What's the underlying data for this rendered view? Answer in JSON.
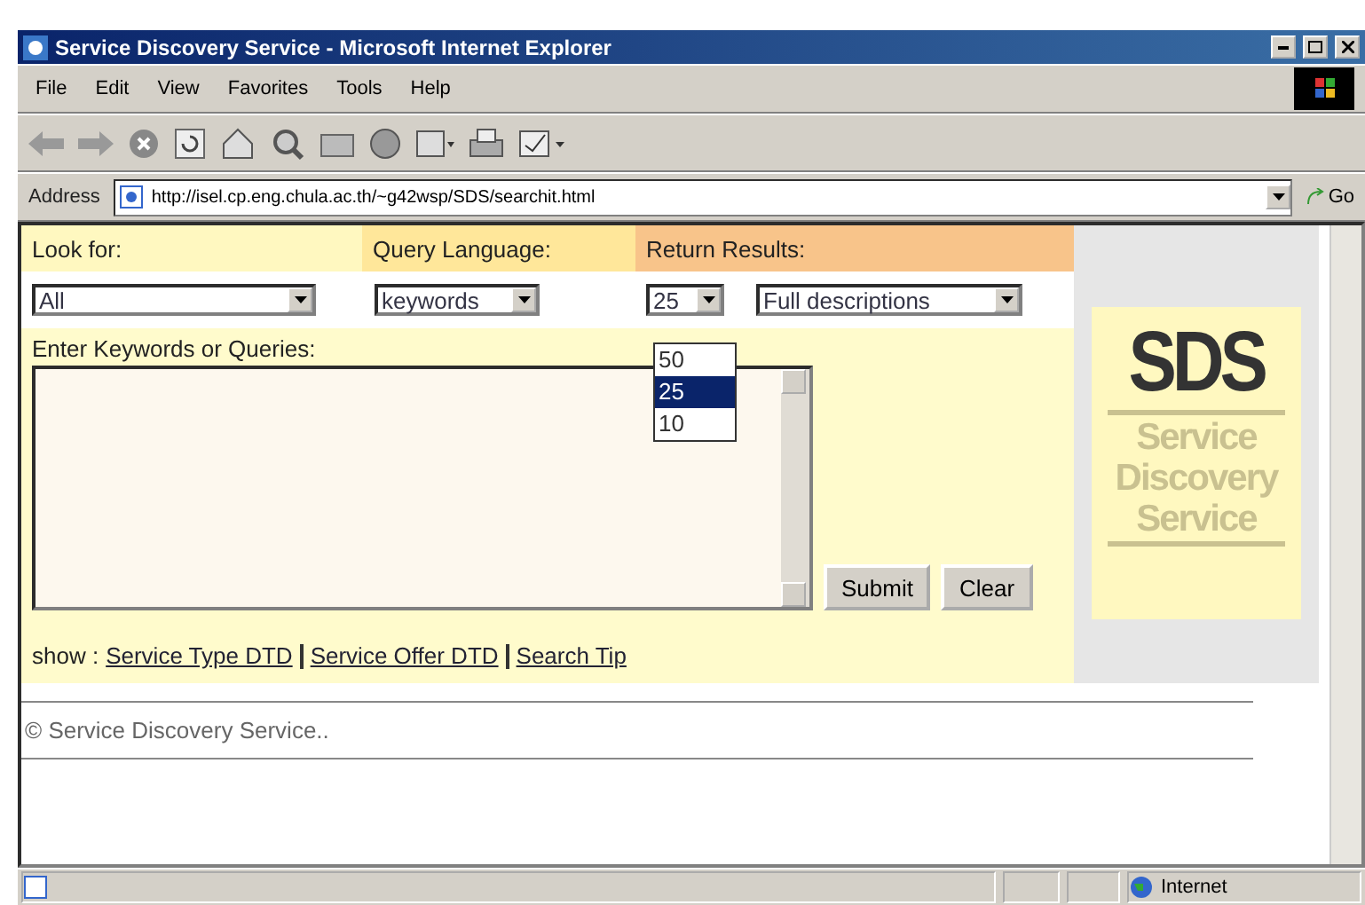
{
  "window": {
    "title": "Service Discovery Service - Microsoft Internet Explorer"
  },
  "menu": [
    "File",
    "Edit",
    "View",
    "Favorites",
    "Tools",
    "Help"
  ],
  "address": {
    "label": "Address",
    "value": "http://isel.cp.eng.chula.ac.th/~g42wsp/SDS/searchit.html",
    "go": "Go"
  },
  "form": {
    "look_for": {
      "label": "Look for:",
      "value": "All"
    },
    "query_language": {
      "label": "Query Language:",
      "value": "keywords"
    },
    "return_results": {
      "label": "Return Results:",
      "count": "25",
      "detail": "Full descriptions"
    },
    "count_options": [
      {
        "label": "50",
        "selected": false
      },
      {
        "label": "25",
        "selected": true
      },
      {
        "label": "10",
        "selected": false
      }
    ],
    "query_label": "Enter Keywords or Queries:",
    "buttons": [
      "Submit",
      "Clear"
    ],
    "show_label": "show :",
    "links": [
      "Service Type DTD",
      "Service Offer DTD",
      "Search Tip"
    ]
  },
  "logo": {
    "mark": "SDS",
    "lines": [
      "Service",
      "Discovery",
      "Service"
    ]
  },
  "footer": "© Service Discovery Service..",
  "status_bar": {
    "zone": "Internet"
  }
}
